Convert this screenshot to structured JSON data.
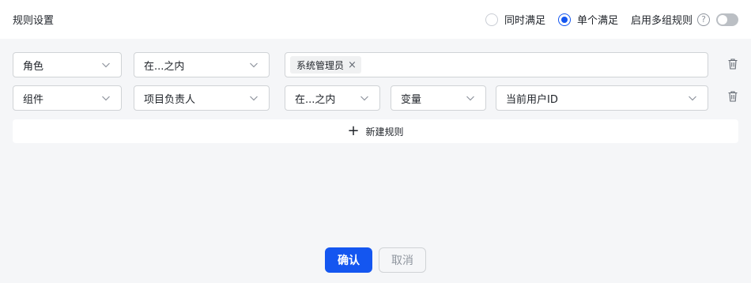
{
  "header": {
    "title": "规则设置",
    "match_all_label": "同时满足",
    "match_one_label": "单个满足",
    "multi_group_label": "启用多组规则",
    "help_glyph": "?",
    "selected_mode": "单个满足",
    "multi_group_enabled": false
  },
  "rules": [
    {
      "field": "角色",
      "operator": "在...之内",
      "tags": [
        "系统管理员"
      ]
    },
    {
      "field": "组件",
      "subfield": "项目负责人",
      "operator": "在...之内",
      "value_type": "变量",
      "value": "当前用户ID"
    }
  ],
  "new_rule_label": "新建规则",
  "footer": {
    "confirm_label": "确认",
    "cancel_label": "取消"
  },
  "colors": {
    "primary": "#1456f0",
    "border": "#d0d3d6",
    "background": "#f5f6f8"
  }
}
